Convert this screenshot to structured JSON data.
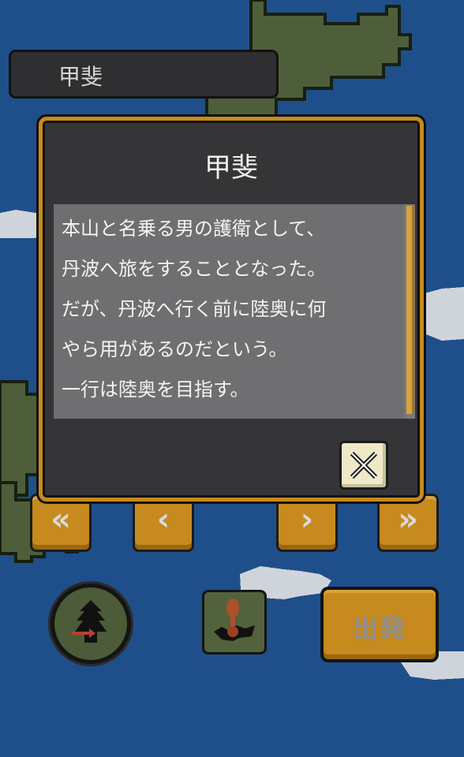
{
  "header": {
    "region_name": "甲斐"
  },
  "dialog": {
    "title": "甲斐",
    "body": "本山と名乗る男の護衛として、\n丹波へ旅をすることとなった。\nだが、丹波へ行く前に陸奥に何\nやら用があるのだという。\n一行は陸奥を目指す。",
    "close_icon": "close-x-icon"
  },
  "navigation": {
    "first": "«",
    "prev": "‹",
    "next": "›",
    "last": "»"
  },
  "toolbar": {
    "depart_label": "出発",
    "compass_icon": "castle-compass-icon",
    "pin_icon": "map-pin-icon"
  },
  "colors": {
    "sea": "#1f4f8a",
    "land": "#4e5e3a",
    "accent": "#c68a1e",
    "dialog_bg": "#353537",
    "text_panel": "#6f6f71"
  }
}
